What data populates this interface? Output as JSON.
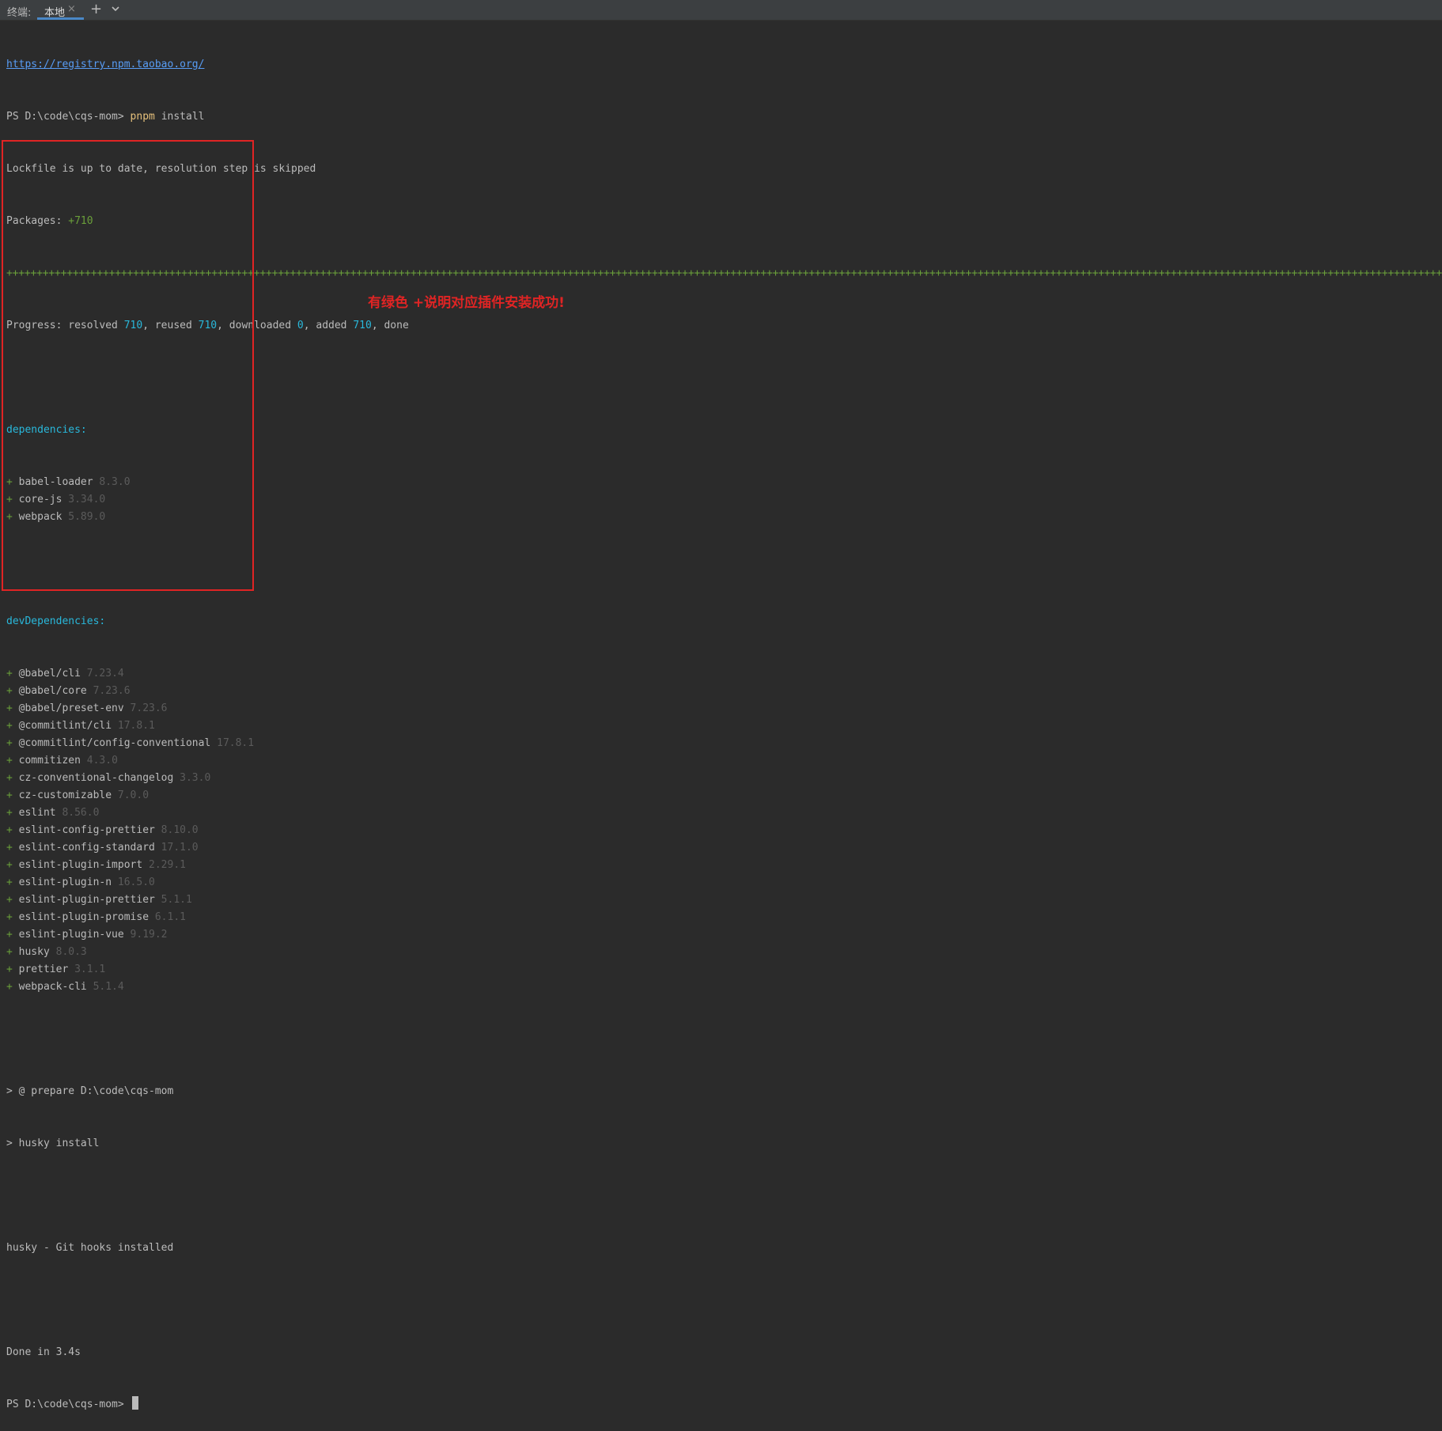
{
  "tabbar": {
    "label": "终端:",
    "tab_name": "本地",
    "close_glyph": "×",
    "add_glyph": "+",
    "add_icon": "plus-icon",
    "dropdown_icon": "chevron-down-icon"
  },
  "terminal": {
    "registry_url": "https://registry.npm.taobao.org/",
    "prompt": "PS D:\\code\\cqs-mom>",
    "command_name": "pnpm",
    "command_args": "install",
    "lockfile_msg": "Lockfile is up to date, resolution step is skipped",
    "packages_label": "Packages:",
    "packages_count": "+710",
    "progress": {
      "prefix": "Progress: resolved",
      "resolved": "710",
      "reused_label": ", reused",
      "reused": "710",
      "downloaded_label": ", downloaded",
      "downloaded": "0",
      "added_label": ", added",
      "added": "710",
      "suffix": ", done"
    },
    "dependencies_header": "dependencies:",
    "dependencies": [
      {
        "name": "babel-loader",
        "version": "8.3.0"
      },
      {
        "name": "core-js",
        "version": "3.34.0"
      },
      {
        "name": "webpack",
        "version": "5.89.0"
      }
    ],
    "dev_dependencies_header": "devDependencies:",
    "dev_dependencies": [
      {
        "name": "@babel/cli",
        "version": "7.23.4"
      },
      {
        "name": "@babel/core",
        "version": "7.23.6"
      },
      {
        "name": "@babel/preset-env",
        "version": "7.23.6"
      },
      {
        "name": "@commitlint/cli",
        "version": "17.8.1"
      },
      {
        "name": "@commitlint/config-conventional",
        "version": "17.8.1"
      },
      {
        "name": "commitizen",
        "version": "4.3.0"
      },
      {
        "name": "cz-conventional-changelog",
        "version": "3.3.0"
      },
      {
        "name": "cz-customizable",
        "version": "7.0.0"
      },
      {
        "name": "eslint",
        "version": "8.56.0"
      },
      {
        "name": "eslint-config-prettier",
        "version": "8.10.0"
      },
      {
        "name": "eslint-config-standard",
        "version": "17.1.0"
      },
      {
        "name": "eslint-plugin-import",
        "version": "2.29.1"
      },
      {
        "name": "eslint-plugin-n",
        "version": "16.5.0"
      },
      {
        "name": "eslint-plugin-prettier",
        "version": "5.1.1"
      },
      {
        "name": "eslint-plugin-promise",
        "version": "6.1.1"
      },
      {
        "name": "eslint-plugin-vue",
        "version": "9.19.2"
      },
      {
        "name": "husky",
        "version": "8.0.3"
      },
      {
        "name": "prettier",
        "version": "3.1.1"
      },
      {
        "name": "webpack-cli",
        "version": "5.1.4"
      }
    ],
    "prepare_line": "> @ prepare D:\\code\\cqs-mom",
    "husky_install_line": "> husky install",
    "husky_msg": "husky - Git hooks installed",
    "done_msg": "Done in 3.4s"
  },
  "annotation": "有绿色 +说明对应插件安装成功!",
  "colors": {
    "background": "#2b2b2b",
    "text": "#bbbbbb",
    "green": "#6a9f3a",
    "cyan": "#29b8db",
    "yellow": "#e5c07b",
    "link": "#589df6",
    "annotation_red": "#e02424"
  }
}
